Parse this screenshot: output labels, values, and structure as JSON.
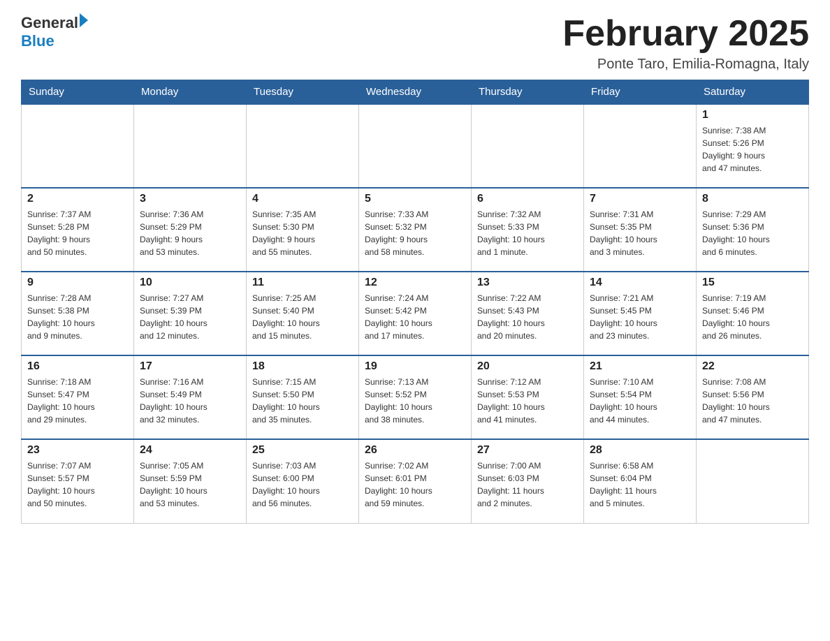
{
  "header": {
    "logo_general": "General",
    "logo_blue": "Blue",
    "title": "February 2025",
    "subtitle": "Ponte Taro, Emilia-Romagna, Italy"
  },
  "weekdays": [
    "Sunday",
    "Monday",
    "Tuesday",
    "Wednesday",
    "Thursday",
    "Friday",
    "Saturday"
  ],
  "weeks": [
    [
      {
        "day": "",
        "info": ""
      },
      {
        "day": "",
        "info": ""
      },
      {
        "day": "",
        "info": ""
      },
      {
        "day": "",
        "info": ""
      },
      {
        "day": "",
        "info": ""
      },
      {
        "day": "",
        "info": ""
      },
      {
        "day": "1",
        "info": "Sunrise: 7:38 AM\nSunset: 5:26 PM\nDaylight: 9 hours\nand 47 minutes."
      }
    ],
    [
      {
        "day": "2",
        "info": "Sunrise: 7:37 AM\nSunset: 5:28 PM\nDaylight: 9 hours\nand 50 minutes."
      },
      {
        "day": "3",
        "info": "Sunrise: 7:36 AM\nSunset: 5:29 PM\nDaylight: 9 hours\nand 53 minutes."
      },
      {
        "day": "4",
        "info": "Sunrise: 7:35 AM\nSunset: 5:30 PM\nDaylight: 9 hours\nand 55 minutes."
      },
      {
        "day": "5",
        "info": "Sunrise: 7:33 AM\nSunset: 5:32 PM\nDaylight: 9 hours\nand 58 minutes."
      },
      {
        "day": "6",
        "info": "Sunrise: 7:32 AM\nSunset: 5:33 PM\nDaylight: 10 hours\nand 1 minute."
      },
      {
        "day": "7",
        "info": "Sunrise: 7:31 AM\nSunset: 5:35 PM\nDaylight: 10 hours\nand 3 minutes."
      },
      {
        "day": "8",
        "info": "Sunrise: 7:29 AM\nSunset: 5:36 PM\nDaylight: 10 hours\nand 6 minutes."
      }
    ],
    [
      {
        "day": "9",
        "info": "Sunrise: 7:28 AM\nSunset: 5:38 PM\nDaylight: 10 hours\nand 9 minutes."
      },
      {
        "day": "10",
        "info": "Sunrise: 7:27 AM\nSunset: 5:39 PM\nDaylight: 10 hours\nand 12 minutes."
      },
      {
        "day": "11",
        "info": "Sunrise: 7:25 AM\nSunset: 5:40 PM\nDaylight: 10 hours\nand 15 minutes."
      },
      {
        "day": "12",
        "info": "Sunrise: 7:24 AM\nSunset: 5:42 PM\nDaylight: 10 hours\nand 17 minutes."
      },
      {
        "day": "13",
        "info": "Sunrise: 7:22 AM\nSunset: 5:43 PM\nDaylight: 10 hours\nand 20 minutes."
      },
      {
        "day": "14",
        "info": "Sunrise: 7:21 AM\nSunset: 5:45 PM\nDaylight: 10 hours\nand 23 minutes."
      },
      {
        "day": "15",
        "info": "Sunrise: 7:19 AM\nSunset: 5:46 PM\nDaylight: 10 hours\nand 26 minutes."
      }
    ],
    [
      {
        "day": "16",
        "info": "Sunrise: 7:18 AM\nSunset: 5:47 PM\nDaylight: 10 hours\nand 29 minutes."
      },
      {
        "day": "17",
        "info": "Sunrise: 7:16 AM\nSunset: 5:49 PM\nDaylight: 10 hours\nand 32 minutes."
      },
      {
        "day": "18",
        "info": "Sunrise: 7:15 AM\nSunset: 5:50 PM\nDaylight: 10 hours\nand 35 minutes."
      },
      {
        "day": "19",
        "info": "Sunrise: 7:13 AM\nSunset: 5:52 PM\nDaylight: 10 hours\nand 38 minutes."
      },
      {
        "day": "20",
        "info": "Sunrise: 7:12 AM\nSunset: 5:53 PM\nDaylight: 10 hours\nand 41 minutes."
      },
      {
        "day": "21",
        "info": "Sunrise: 7:10 AM\nSunset: 5:54 PM\nDaylight: 10 hours\nand 44 minutes."
      },
      {
        "day": "22",
        "info": "Sunrise: 7:08 AM\nSunset: 5:56 PM\nDaylight: 10 hours\nand 47 minutes."
      }
    ],
    [
      {
        "day": "23",
        "info": "Sunrise: 7:07 AM\nSunset: 5:57 PM\nDaylight: 10 hours\nand 50 minutes."
      },
      {
        "day": "24",
        "info": "Sunrise: 7:05 AM\nSunset: 5:59 PM\nDaylight: 10 hours\nand 53 minutes."
      },
      {
        "day": "25",
        "info": "Sunrise: 7:03 AM\nSunset: 6:00 PM\nDaylight: 10 hours\nand 56 minutes."
      },
      {
        "day": "26",
        "info": "Sunrise: 7:02 AM\nSunset: 6:01 PM\nDaylight: 10 hours\nand 59 minutes."
      },
      {
        "day": "27",
        "info": "Sunrise: 7:00 AM\nSunset: 6:03 PM\nDaylight: 11 hours\nand 2 minutes."
      },
      {
        "day": "28",
        "info": "Sunrise: 6:58 AM\nSunset: 6:04 PM\nDaylight: 11 hours\nand 5 minutes."
      },
      {
        "day": "",
        "info": ""
      }
    ]
  ]
}
